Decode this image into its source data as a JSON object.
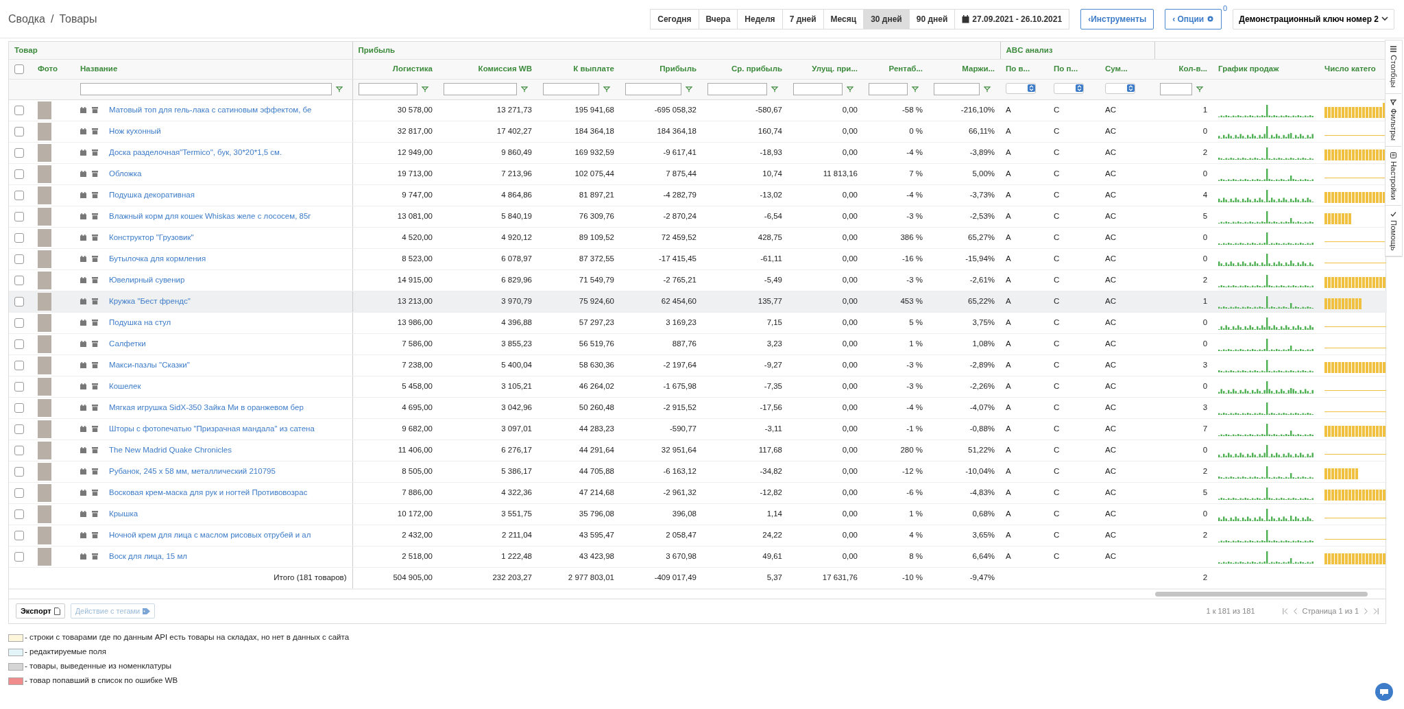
{
  "breadcrumb": [
    "Сводка",
    "Товары"
  ],
  "breadcrumb_separator": "/",
  "periods": [
    {
      "label": "Сегодня",
      "selected": false
    },
    {
      "label": "Вчера",
      "selected": false
    },
    {
      "label": "Неделя",
      "selected": false
    },
    {
      "label": "7 дней",
      "selected": false
    },
    {
      "label": "Месяц",
      "selected": false
    },
    {
      "label": "30 дней",
      "selected": true
    },
    {
      "label": "90 дней",
      "selected": false
    }
  ],
  "date_range": "27.09.2021 - 26.10.2021",
  "tools_button": "‹Инструменты",
  "options_button": {
    "label": "‹ Опции",
    "badge": "0"
  },
  "account_dropdown": "Демонстрационный ключ номер 2",
  "table": {
    "column_groups": [
      {
        "label": "Товар",
        "columns": [
          {
            "kind": "select",
            "checked": false
          },
          {
            "kind": "photo",
            "label": "Фото"
          },
          {
            "kind": "name",
            "label": "Название",
            "text_filter": true
          }
        ]
      },
      {
        "label": "Прибыль",
        "columns": [
          {
            "kind": "number",
            "label": "Логистика",
            "text_filter": true
          },
          {
            "kind": "number",
            "label": "Комиссия WB",
            "text_filter": true
          },
          {
            "kind": "number",
            "label": "К выплате",
            "text_filter": true
          },
          {
            "kind": "number",
            "label": "Прибыль",
            "text_filter": true
          },
          {
            "kind": "number",
            "label": "Ср. прибыль",
            "text_filter": true
          },
          {
            "kind": "number",
            "label": "Улущ. при...",
            "text_filter": true
          },
          {
            "kind": "number",
            "label": "Рентаб...",
            "text_filter": true
          },
          {
            "kind": "number",
            "label": "Маржи...",
            "text_filter": true
          }
        ]
      },
      {
        "label": "ABC анализ",
        "columns": [
          {
            "kind": "abc",
            "label": "По в...",
            "dropdown_filter": true
          },
          {
            "kind": "abc",
            "label": "По п...",
            "dropdown_filter": true
          },
          {
            "kind": "abc",
            "label": "Сум...",
            "dropdown_filter": true
          }
        ]
      },
      {
        "columns": [
          {
            "kind": "count",
            "label": "Кол-в...",
            "text_filter": true
          },
          {
            "kind": "sales_chart",
            "label": "График продаж"
          },
          {
            "kind": "category_chart",
            "label": "Число катего"
          }
        ]
      }
    ],
    "rows": [
      {
        "name": "Матовый топ для гель-лака с сатиновым эффектом, бе",
        "checked": false,
        "hovered": false,
        "values": [
          "30 578,00",
          "13 271,73",
          "195 941,68",
          "-695 058,32",
          "-580,67",
          "0,00",
          "-58 %",
          "-216,10%",
          "A",
          "C",
          "AC",
          "1"
        ]
      },
      {
        "name": "Нож кухонный",
        "checked": false,
        "hovered": false,
        "values": [
          "32 817,00",
          "17 402,27",
          "184 364,18",
          "184 364,18",
          "160,74",
          "0,00",
          "0 %",
          "66,11%",
          "A",
          "C",
          "AC",
          "0"
        ]
      },
      {
        "name": "Доска разделочная\"Termico\", бук, 30*20*1,5 см.",
        "checked": false,
        "hovered": false,
        "values": [
          "12 949,00",
          "9 860,49",
          "169 932,59",
          "-9 617,41",
          "-18,93",
          "0,00",
          "-4 %",
          "-3,89%",
          "A",
          "C",
          "AC",
          "2"
        ]
      },
      {
        "name": "Обложка",
        "checked": false,
        "hovered": false,
        "values": [
          "19 713,00",
          "7 213,96",
          "102 075,44",
          "7 875,44",
          "10,74",
          "11 813,16",
          "7 %",
          "5,00%",
          "A",
          "C",
          "AC",
          "0"
        ]
      },
      {
        "name": "Подушка декоративная",
        "checked": false,
        "hovered": false,
        "values": [
          "9 747,00",
          "4 864,86",
          "81 897,21",
          "-4 282,79",
          "-13,02",
          "0,00",
          "-4 %",
          "-3,73%",
          "A",
          "C",
          "AC",
          "4"
        ]
      },
      {
        "name": "Влажный корм для кошек Whiskas желе с лососем, 85г",
        "checked": false,
        "hovered": false,
        "values": [
          "13 081,00",
          "5 840,19",
          "76 309,76",
          "-2 870,24",
          "-6,54",
          "0,00",
          "-3 %",
          "-2,53%",
          "A",
          "C",
          "AC",
          "5"
        ]
      },
      {
        "name": "Конструктор \"Грузовик\"",
        "checked": false,
        "hovered": false,
        "values": [
          "4 520,00",
          "4 920,12",
          "89 109,52",
          "72 459,52",
          "428,75",
          "0,00",
          "386 %",
          "65,27%",
          "A",
          "C",
          "AC",
          "0"
        ]
      },
      {
        "name": "Бутылочка для кормления",
        "checked": false,
        "hovered": false,
        "values": [
          "8 523,00",
          "6 078,97",
          "87 372,55",
          "-17 415,45",
          "-61,11",
          "0,00",
          "-16 %",
          "-15,94%",
          "A",
          "C",
          "AC",
          "0"
        ]
      },
      {
        "name": "Ювелирный сувенир",
        "checked": false,
        "hovered": false,
        "values": [
          "14 915,00",
          "6 829,96",
          "71 549,79",
          "-2 765,21",
          "-5,49",
          "0,00",
          "-3 %",
          "-2,61%",
          "A",
          "C",
          "AC",
          "2"
        ]
      },
      {
        "name": "Кружка \"Бест френдс\"",
        "checked": false,
        "hovered": true,
        "values": [
          "13 213,00",
          "3 970,79",
          "75 924,60",
          "62 454,60",
          "135,77",
          "0,00",
          "453 %",
          "65,22%",
          "A",
          "C",
          "AC",
          "1"
        ]
      },
      {
        "name": "Подушка на стул",
        "checked": false,
        "hovered": false,
        "values": [
          "13 986,00",
          "4 396,88",
          "57 297,23",
          "3 169,23",
          "7,15",
          "0,00",
          "5 %",
          "3,75%",
          "A",
          "C",
          "AC",
          "0"
        ]
      },
      {
        "name": "Салфетки",
        "checked": false,
        "hovered": false,
        "values": [
          "7 586,00",
          "3 855,23",
          "56 519,76",
          "887,76",
          "3,23",
          "0,00",
          "1 %",
          "1,08%",
          "A",
          "C",
          "AC",
          "0"
        ]
      },
      {
        "name": "Макси-пазлы \"Сказки\"",
        "checked": false,
        "hovered": false,
        "values": [
          "7 238,00",
          "5 400,04",
          "58 630,36",
          "-2 197,64",
          "-9,27",
          "0,00",
          "-3 %",
          "-2,89%",
          "A",
          "C",
          "AC",
          "3"
        ]
      },
      {
        "name": "Кошелек",
        "checked": false,
        "hovered": false,
        "values": [
          "5 458,00",
          "3 105,21",
          "46 264,02",
          "-1 675,98",
          "-7,35",
          "0,00",
          "-3 %",
          "-2,26%",
          "A",
          "C",
          "AC",
          "0"
        ]
      },
      {
        "name": "Мягкая игрушка SidX-350 Зайка Ми в оранжевом бер",
        "checked": false,
        "hovered": false,
        "values": [
          "4 695,00",
          "3 042,96",
          "50 260,48",
          "-2 915,52",
          "-17,56",
          "0,00",
          "-4 %",
          "-4,07%",
          "A",
          "C",
          "AC",
          "3"
        ]
      },
      {
        "name": "Шторы с фотопечатью \"Призрачная мандала\" из сатена",
        "checked": false,
        "hovered": false,
        "values": [
          "9 682,00",
          "3 097,01",
          "44 283,23",
          "-590,77",
          "-3,11",
          "0,00",
          "-1 %",
          "-0,88%",
          "A",
          "C",
          "AC",
          "7"
        ]
      },
      {
        "name": "The New Madrid Quake Chronicles",
        "checked": false,
        "hovered": false,
        "values": [
          "11 406,00",
          "6 276,17",
          "44 291,64",
          "32 951,64",
          "117,68",
          "0,00",
          "280 %",
          "51,22%",
          "A",
          "C",
          "AC",
          "0"
        ]
      },
      {
        "name": "Рубанок, 245 х 58 мм, металлический 210795",
        "checked": false,
        "hovered": false,
        "values": [
          "8 505,00",
          "5 386,17",
          "44 705,88",
          "-6 163,12",
          "-34,82",
          "0,00",
          "-12 %",
          "-10,04%",
          "A",
          "C",
          "AC",
          "2"
        ]
      },
      {
        "name": "Восковая крем-маска для рук и ногтей Противовозрас",
        "checked": false,
        "hovered": false,
        "values": [
          "7 886,00",
          "4 322,36",
          "47 214,68",
          "-2 961,32",
          "-12,82",
          "0,00",
          "-6 %",
          "-4,83%",
          "A",
          "C",
          "AC",
          "5"
        ]
      },
      {
        "name": "Крышка",
        "checked": false,
        "hovered": false,
        "values": [
          "10 172,00",
          "3 551,75",
          "35 796,08",
          "396,08",
          "1,14",
          "0,00",
          "1 %",
          "0,68%",
          "A",
          "C",
          "AC",
          "0"
        ]
      },
      {
        "name": "Ночной крем для лица с маслом рисовых отрубей и ал",
        "checked": false,
        "hovered": false,
        "values": [
          "2 432,00",
          "2 211,04",
          "43 595,47",
          "2 058,47",
          "24,22",
          "0,00",
          "4 %",
          "3,65%",
          "A",
          "C",
          "AC",
          "2"
        ]
      },
      {
        "name": "Воск для лица, 15 мл",
        "checked": false,
        "hovered": false,
        "values": [
          "2 518,00",
          "1 222,48",
          "43 423,98",
          "3 670,98",
          "49,61",
          "0,00",
          "8 %",
          "6,64%",
          "A",
          "C",
          "AC"
        ]
      }
    ],
    "total": {
      "label": "Итого (181 товаров)",
      "values": [
        "504 905,00",
        "232 203,27",
        "2 977 803,01",
        "-409 017,49",
        "5,37",
        "17 631,76",
        "-10 %",
        "-9,47%"
      ],
      "count": "2"
    }
  },
  "side_tabs": [
    {
      "label": "Столбцы",
      "kind": "columns"
    },
    {
      "label": "Фильтры",
      "kind": "filter"
    },
    {
      "label": "Настройки",
      "kind": "settings"
    },
    {
      "label": "Помощь",
      "kind": "help"
    }
  ],
  "export_button": "Экспорт",
  "tags_button": "Действие с тегами",
  "record_range": "1 к 181 из 181",
  "page_info": "Страница 1 из 1",
  "legend": [
    {
      "label": "- строки с товарами где по данным API есть товары на складах, но нет в данных с сайта",
      "color": "#fdf6da"
    },
    {
      "label": "- редактируемые поля",
      "color": "#e3f5f8"
    },
    {
      "label": "- товары, выведенные из номенклатуры",
      "color": "#d5d5d5"
    },
    {
      "label": "- товар попавший в список по ошибке WB",
      "color": "#f08c8c"
    }
  ]
}
